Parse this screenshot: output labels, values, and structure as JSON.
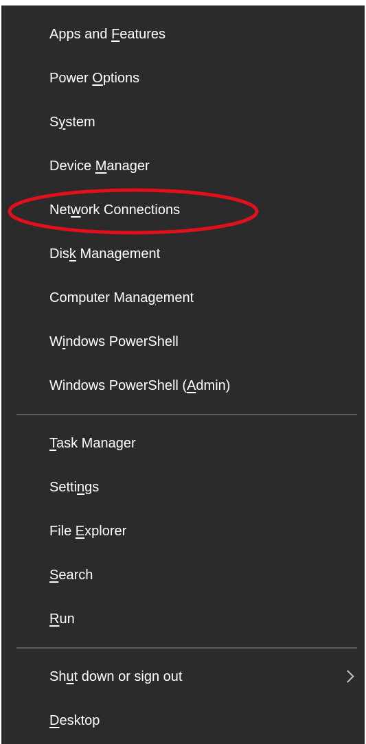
{
  "menu": {
    "group1": [
      {
        "id": "apps-and-features",
        "pre": "Apps and ",
        "key": "F",
        "post": "eatures"
      },
      {
        "id": "power-options",
        "pre": "Power ",
        "key": "O",
        "post": "ptions"
      },
      {
        "id": "system",
        "pre": "S",
        "key": "y",
        "post": "stem"
      },
      {
        "id": "device-manager",
        "pre": "Device ",
        "key": "M",
        "post": "anager"
      },
      {
        "id": "network-connections",
        "pre": "Net",
        "key": "w",
        "post": "ork Connections"
      },
      {
        "id": "disk-management",
        "pre": "Dis",
        "key": "k",
        "post": " Management"
      },
      {
        "id": "computer-management",
        "pre": "Computer Mana",
        "key": "g",
        "post": "ement"
      },
      {
        "id": "windows-powershell",
        "pre": "W",
        "key": "i",
        "post": "ndows PowerShell"
      },
      {
        "id": "windows-powershell-admin",
        "pre": "Windows PowerShell (",
        "key": "A",
        "post": "dmin)"
      }
    ],
    "group2": [
      {
        "id": "task-manager",
        "pre": "",
        "key": "T",
        "post": "ask Manager"
      },
      {
        "id": "settings",
        "pre": "Setti",
        "key": "n",
        "post": "gs"
      },
      {
        "id": "file-explorer",
        "pre": "File ",
        "key": "E",
        "post": "xplorer"
      },
      {
        "id": "search",
        "pre": "",
        "key": "S",
        "post": "earch"
      },
      {
        "id": "run",
        "pre": "",
        "key": "R",
        "post": "un"
      }
    ],
    "group3": [
      {
        "id": "shut-down-or-sign-out",
        "pre": "Sh",
        "key": "u",
        "post": "t down or sign out",
        "submenu": true,
        "chevron_icon": "chevron-right-icon"
      },
      {
        "id": "desktop",
        "pre": "",
        "key": "D",
        "post": "esktop"
      }
    ]
  },
  "colors": {
    "menu_background": "#2b2b2b",
    "text": "#ffffff",
    "separator": "#5d5d5d",
    "annotation": "#e0101c"
  }
}
